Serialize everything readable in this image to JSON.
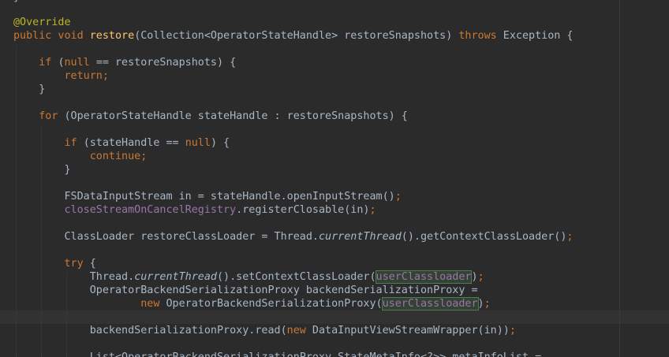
{
  "editor": {
    "top_fragment": "}",
    "lines": [
      [
        {
          "t": "@Override",
          "c": "ann"
        }
      ],
      [
        {
          "t": "public void ",
          "c": "kw"
        },
        {
          "t": "restore",
          "c": "fn"
        },
        {
          "t": "(Collection<OperatorStateHandle> restoreSnapshots) ",
          "c": ""
        },
        {
          "t": "throws ",
          "c": "kw"
        },
        {
          "t": "Exception {",
          "c": ""
        }
      ],
      [],
      [
        {
          "t": "    ",
          "c": ""
        },
        {
          "t": "if ",
          "c": "kw"
        },
        {
          "t": "(",
          "c": ""
        },
        {
          "t": "null ",
          "c": "kw"
        },
        {
          "t": "== restoreSnapshots) {",
          "c": ""
        }
      ],
      [
        {
          "t": "        ",
          "c": ""
        },
        {
          "t": "return;",
          "c": "kw"
        }
      ],
      [
        {
          "t": "    }",
          "c": ""
        }
      ],
      [],
      [
        {
          "t": "    ",
          "c": ""
        },
        {
          "t": "for ",
          "c": "kw"
        },
        {
          "t": "(OperatorStateHandle stateHandle : restoreSnapshots) {",
          "c": ""
        }
      ],
      [],
      [
        {
          "t": "        ",
          "c": ""
        },
        {
          "t": "if ",
          "c": "kw"
        },
        {
          "t": "(stateHandle == ",
          "c": ""
        },
        {
          "t": "null",
          "c": "kw"
        },
        {
          "t": ") {",
          "c": ""
        }
      ],
      [
        {
          "t": "            ",
          "c": ""
        },
        {
          "t": "continue;",
          "c": "kw"
        }
      ],
      [
        {
          "t": "        }",
          "c": ""
        }
      ],
      [],
      [
        {
          "t": "        FSDataInputStream in = stateHandle.openInputStream()",
          "c": ""
        },
        {
          "t": ";",
          "c": "kw"
        }
      ],
      [
        {
          "t": "        ",
          "c": ""
        },
        {
          "t": "closeStreamOnCancelRegistry",
          "c": "field"
        },
        {
          "t": ".registerClosable(in)",
          "c": ""
        },
        {
          "t": ";",
          "c": "kw"
        }
      ],
      [],
      [
        {
          "t": "        ClassLoader restoreClassLoader = Thread.",
          "c": ""
        },
        {
          "t": "currentThread",
          "c": "it"
        },
        {
          "t": "().getContextClassLoader()",
          "c": ""
        },
        {
          "t": ";",
          "c": "kw"
        }
      ],
      [],
      [
        {
          "t": "        ",
          "c": ""
        },
        {
          "t": "try ",
          "c": "kw"
        },
        {
          "t": "{",
          "c": ""
        }
      ],
      [
        {
          "t": "            Thread.",
          "c": ""
        },
        {
          "t": "currentThread",
          "c": "it"
        },
        {
          "t": "().setContextClassLoader(",
          "c": ""
        },
        {
          "t": "userClassloader",
          "c": "hl"
        },
        {
          "t": ")",
          "c": ""
        },
        {
          "t": ";",
          "c": "kw"
        }
      ],
      [
        {
          "t": "            OperatorBackendSerializationProxy backendSerializationProxy =",
          "c": ""
        }
      ],
      [
        {
          "t": "                    ",
          "c": ""
        },
        {
          "t": "new ",
          "c": "kw"
        },
        {
          "t": "OperatorBackendSerializationProxy(",
          "c": ""
        },
        {
          "t": "userClassloader",
          "c": "hl"
        },
        {
          "t": ")",
          "c": ""
        },
        {
          "t": ";",
          "c": "kw"
        }
      ],
      [],
      [
        {
          "t": "            backendSerializationProxy.read(",
          "c": ""
        },
        {
          "t": "new ",
          "c": "kw"
        },
        {
          "t": "DataInputViewStreamWrapper(in))",
          "c": ""
        },
        {
          "t": ";",
          "c": "kw"
        }
      ],
      [],
      [
        {
          "t": "            List<OperatorBackendSerializationProxy.StateMetaInfo<?>> metaInfoList =",
          "c": ""
        }
      ]
    ]
  }
}
